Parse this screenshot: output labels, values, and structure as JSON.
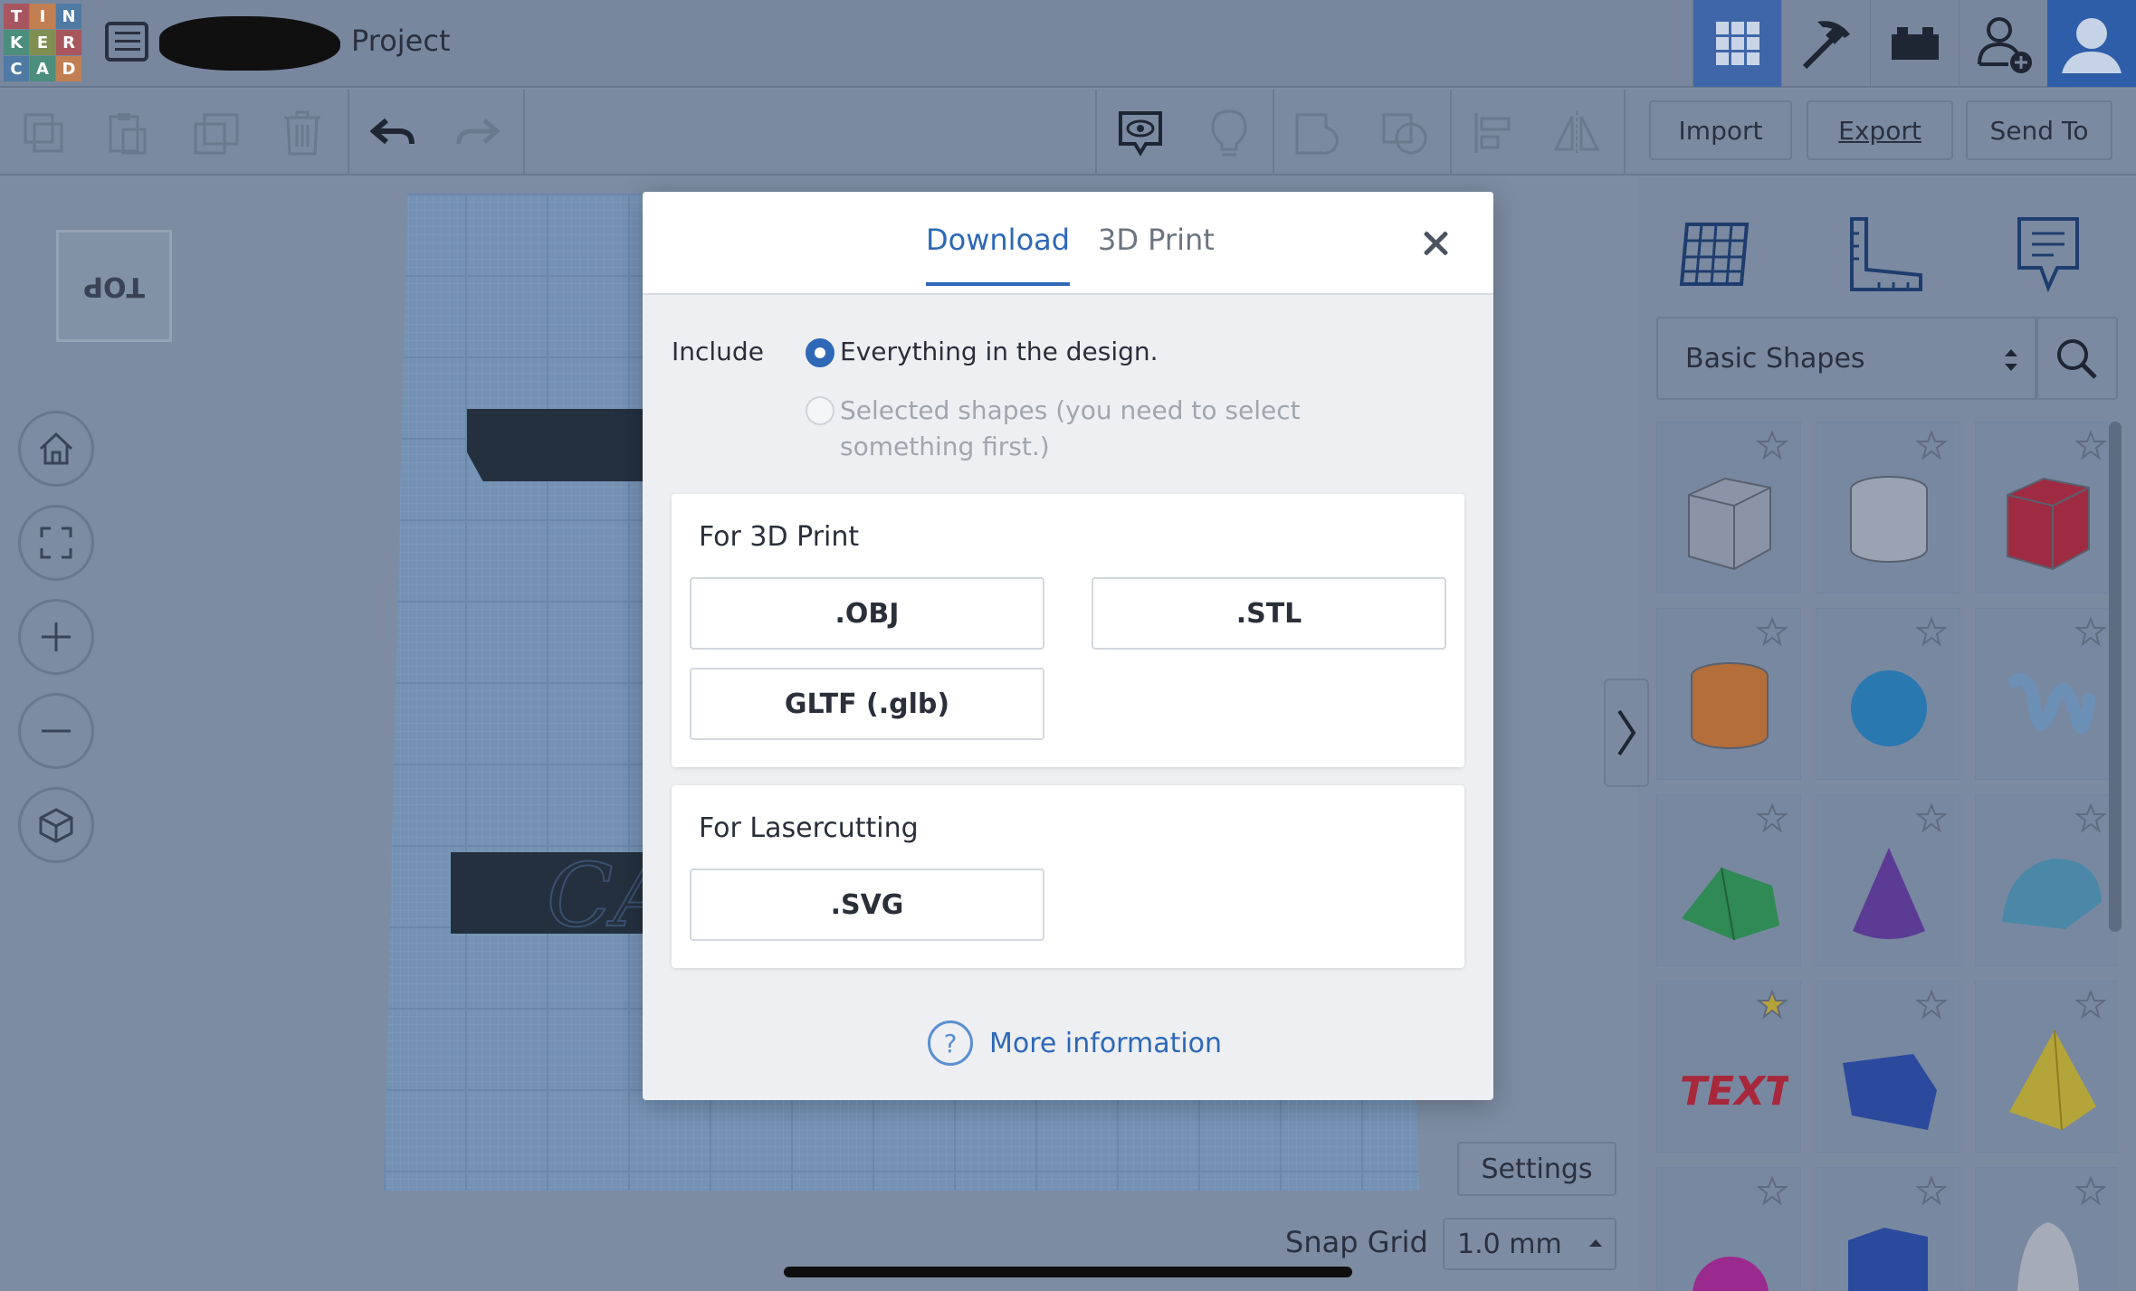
{
  "logo": {
    "letters": [
      "T",
      "I",
      "N",
      "K",
      "E",
      "R",
      "C",
      "A",
      "D"
    ]
  },
  "header": {
    "project_title": "Project"
  },
  "toolbar": {
    "import_label": "Import",
    "export_label": "Export",
    "send_to_label": "Send To"
  },
  "viewcube": {
    "face_label": "TOP"
  },
  "panel": {
    "shape_category": "Basic Shapes",
    "shapes": [
      {
        "name": "Box",
        "color": "#8a94a6"
      },
      {
        "name": "Cylinder",
        "color": "#9aa3b2"
      },
      {
        "name": "Box",
        "color": "#9e2b41"
      },
      {
        "name": "Cylinder",
        "color": "#b36e3a"
      },
      {
        "name": "Sphere",
        "color": "#2a78b0"
      },
      {
        "name": "Scribble",
        "color": "#6c8fb6"
      },
      {
        "name": "Roof",
        "color": "#2f8a55"
      },
      {
        "name": "Cone",
        "color": "#5b3b93"
      },
      {
        "name": "Round Roof",
        "color": "#4b88a8"
      },
      {
        "name": "Text",
        "color": "#a8273a"
      },
      {
        "name": "Wedge",
        "color": "#2b4a9e"
      },
      {
        "name": "Pyramid",
        "color": "#b4a53a"
      },
      {
        "name": "Half Sphere",
        "color": "#9b2a8e"
      },
      {
        "name": "Polygon",
        "color": "#2a4a9e"
      },
      {
        "name": "Paraboloid",
        "color": "#a5acb8"
      }
    ]
  },
  "bottom": {
    "settings_label": "Settings",
    "snap_grid_label": "Snap Grid",
    "snap_grid_value": "1.0 mm"
  },
  "modal": {
    "tabs": [
      {
        "label": "Download",
        "active": true
      },
      {
        "label": "3D Print",
        "active": false
      }
    ],
    "include_label": "Include",
    "option_everything": "Everything in the design.",
    "option_selected": "Selected shapes (you need to select something first.)",
    "print_section_title": "For 3D Print",
    "print_formats": [
      ".OBJ",
      ".STL",
      "GLTF (.glb)"
    ],
    "laser_section_title": "For Lasercutting",
    "laser_formats": [
      ".SVG"
    ],
    "more_info_label": "More information",
    "help_glyph": "?",
    "accent_color": "#2e68b7"
  }
}
